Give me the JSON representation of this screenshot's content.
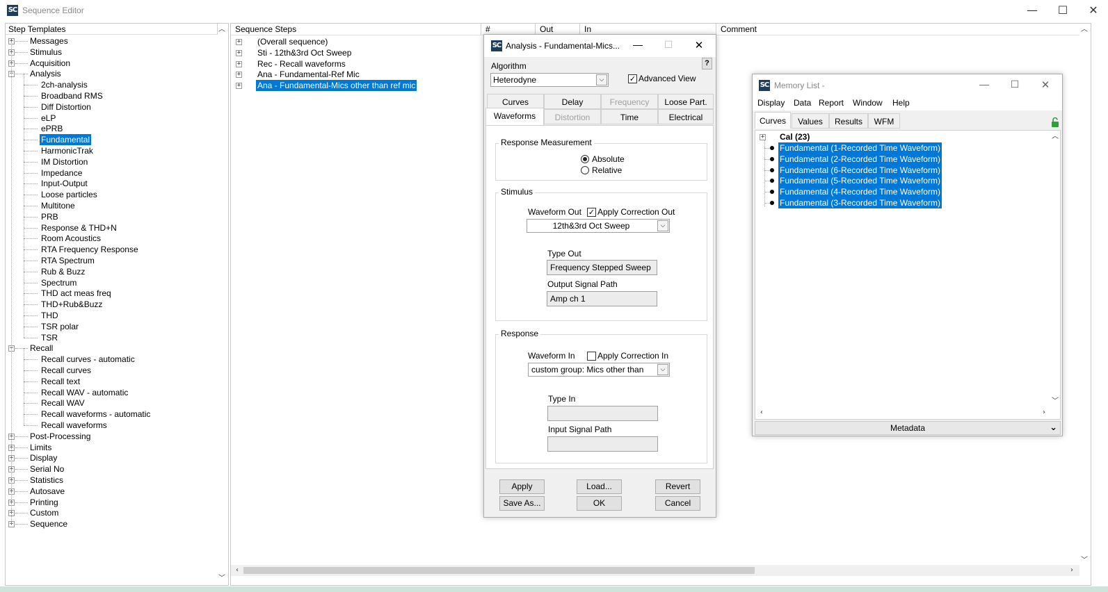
{
  "main_window": {
    "title": "Sequence Editor",
    "minimize_glyph": "—",
    "maximize_glyph": "☐",
    "close_glyph": "✕"
  },
  "left_panel": {
    "header": "Step Templates",
    "items": [
      {
        "label": "Messages",
        "type": "group",
        "expanded": false
      },
      {
        "label": "Stimulus",
        "type": "group",
        "expanded": false
      },
      {
        "label": "Acquisition",
        "type": "group",
        "expanded": false
      },
      {
        "label": "Analysis",
        "type": "group",
        "expanded": true
      },
      {
        "label": "2ch-analysis",
        "type": "child"
      },
      {
        "label": "Broadband RMS",
        "type": "child"
      },
      {
        "label": "Diff Distortion",
        "type": "child"
      },
      {
        "label": "eLP",
        "type": "child"
      },
      {
        "label": "ePRB",
        "type": "child"
      },
      {
        "label": "Fundamental",
        "type": "child",
        "selected": true
      },
      {
        "label": "HarmonicTrak",
        "type": "child"
      },
      {
        "label": "IM Distortion",
        "type": "child"
      },
      {
        "label": "Impedance",
        "type": "child"
      },
      {
        "label": "Input-Output",
        "type": "child"
      },
      {
        "label": "Loose particles",
        "type": "child"
      },
      {
        "label": "Multitone",
        "type": "child"
      },
      {
        "label": "PRB",
        "type": "child"
      },
      {
        "label": "Response & THD+N",
        "type": "child"
      },
      {
        "label": "Room Acoustics",
        "type": "child"
      },
      {
        "label": "RTA Frequency Response",
        "type": "child"
      },
      {
        "label": "RTA Spectrum",
        "type": "child"
      },
      {
        "label": "Rub & Buzz",
        "type": "child"
      },
      {
        "label": "Spectrum",
        "type": "child"
      },
      {
        "label": "THD act meas freq",
        "type": "child"
      },
      {
        "label": "THD+Rub&Buzz",
        "type": "child"
      },
      {
        "label": "THD",
        "type": "child"
      },
      {
        "label": "TSR polar",
        "type": "child"
      },
      {
        "label": "TSR",
        "type": "child"
      },
      {
        "label": "Recall",
        "type": "group",
        "expanded": true
      },
      {
        "label": "Recall curves - automatic",
        "type": "child"
      },
      {
        "label": "Recall curves",
        "type": "child"
      },
      {
        "label": "Recall text",
        "type": "child"
      },
      {
        "label": "Recall WAV - automatic",
        "type": "child"
      },
      {
        "label": "Recall WAV",
        "type": "child"
      },
      {
        "label": "Recall waveforms - automatic",
        "type": "child"
      },
      {
        "label": "Recall waveforms",
        "type": "child"
      },
      {
        "label": "Post-Processing",
        "type": "group",
        "expanded": false
      },
      {
        "label": "Limits",
        "type": "group",
        "expanded": false
      },
      {
        "label": "Display",
        "type": "group",
        "expanded": false
      },
      {
        "label": "Serial No",
        "type": "group",
        "expanded": false
      },
      {
        "label": "Statistics",
        "type": "group",
        "expanded": false
      },
      {
        "label": "Autosave",
        "type": "group",
        "expanded": false
      },
      {
        "label": "Printing",
        "type": "group",
        "expanded": false
      },
      {
        "label": "Custom",
        "type": "group",
        "expanded": false
      },
      {
        "label": "Sequence",
        "type": "group",
        "expanded": false
      }
    ]
  },
  "sequence_panel": {
    "columns": [
      "Sequence Steps",
      "#",
      "Out",
      "In",
      "Comment"
    ],
    "steps": [
      {
        "label": "(Overall sequence)",
        "selected": false
      },
      {
        "label": "Sti - 12th&3rd Oct Sweep",
        "selected": false
      },
      {
        "label": "Rec - Recall waveforms",
        "selected": false
      },
      {
        "label": "Ana - Fundamental-Ref Mic",
        "selected": false
      },
      {
        "label": "Ana - Fundamental-Mics other than ref mic",
        "selected": true
      }
    ]
  },
  "analysis_dialog": {
    "title": "Analysis  - Fundamental-Mics...",
    "algorithm_label": "Algorithm",
    "algorithm_value": "Heterodyne",
    "advanced_view_label": "Advanced View",
    "advanced_view_checked": true,
    "help_button": "?",
    "tabs_row1": [
      "Curves",
      "Delay",
      "Frequency",
      "Loose Part."
    ],
    "tabs_row2": [
      "Waveforms",
      "Distortion",
      "Time",
      "Electrical"
    ],
    "active_tab": "Waveforms",
    "response_measurement": {
      "title": "Response Measurement",
      "options": [
        "Absolute",
        "Relative"
      ],
      "selected": "Absolute"
    },
    "stimulus": {
      "title": "Stimulus",
      "waveform_out_label": "Waveform Out",
      "apply_correction_out_label": "Apply Correction Out",
      "apply_correction_out_checked": true,
      "waveform_out_value": "12th&3rd Oct Sweep",
      "type_out_label": "Type Out",
      "type_out_value": "Frequency Stepped Sweep",
      "output_signal_path_label": "Output Signal Path",
      "output_signal_path_value": "Amp ch 1"
    },
    "response": {
      "title": "Response",
      "waveform_in_label": "Waveform In",
      "apply_correction_in_label": "Apply Correction In",
      "apply_correction_in_checked": false,
      "waveform_in_value": "custom group: Mics other than",
      "type_in_label": "Type In",
      "type_in_value": "",
      "input_signal_path_label": "Input Signal Path",
      "input_signal_path_value": ""
    },
    "buttons": {
      "apply": "Apply",
      "load": "Load...",
      "revert": "Revert",
      "save_as": "Save As...",
      "ok": "OK",
      "cancel": "Cancel"
    }
  },
  "memory_list": {
    "title": "Memory List -",
    "menu": [
      "Display",
      "Data",
      "Report",
      "Window",
      "Help"
    ],
    "tabs": [
      "Curves",
      "Values",
      "Results",
      "WFM"
    ],
    "active_tab": "Curves",
    "group_label": "Cal (23)",
    "items": [
      "Fundamental (1-Recorded Time Waveform)",
      "Fundamental (2-Recorded Time Waveform)",
      "Fundamental (6-Recorded Time Waveform)",
      "Fundamental (5-Recorded Time Waveform)",
      "Fundamental (4-Recorded Time Waveform)",
      "Fundamental (3-Recorded Time Waveform)"
    ],
    "metadata_label": "Metadata"
  }
}
